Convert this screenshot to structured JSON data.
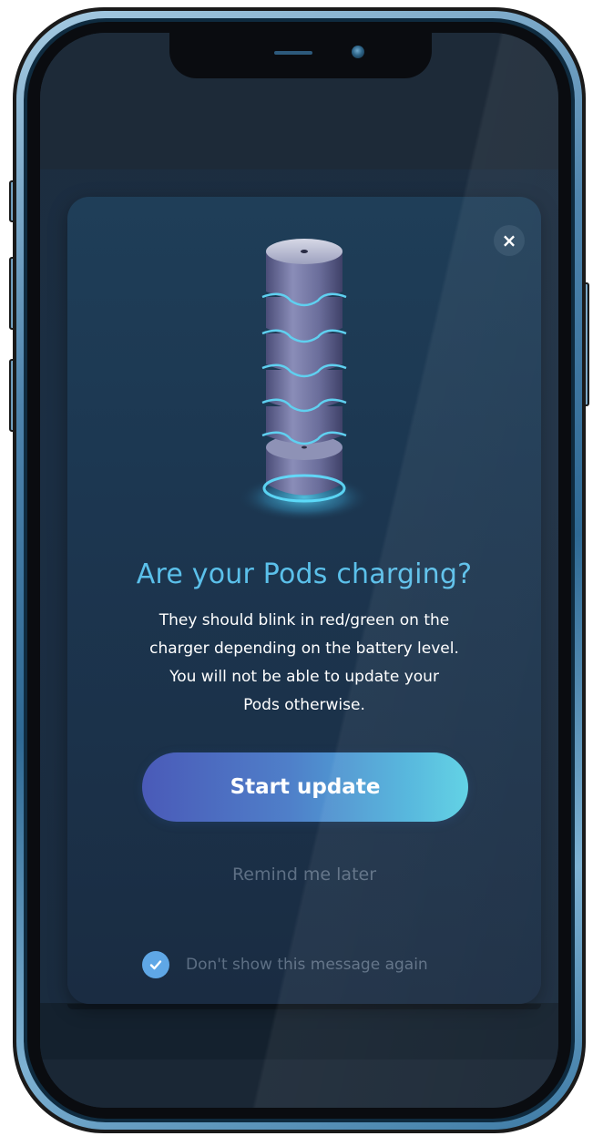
{
  "modal": {
    "close_icon": "×",
    "title": "Are your Pods charging?",
    "body_lines": [
      "They should blink in red/green on the",
      "charger depending on the battery level.",
      "You will not be able to update your",
      "Pods otherwise."
    ],
    "primary_button": "Start update",
    "secondary_link": "Remind me later",
    "checkbox": {
      "label": "Don't show this message again",
      "checked": true
    }
  },
  "colors": {
    "title": "#5bc0ea",
    "button_gradient_start": "#4a5ab8",
    "button_gradient_end": "#5cd1e4",
    "checkbox": "#5fa7e6",
    "muted_text": "#5d6f84"
  },
  "icons": {
    "close": "close-icon",
    "checkbox": "check-icon",
    "illustration": "charging-pods-stack-icon"
  }
}
